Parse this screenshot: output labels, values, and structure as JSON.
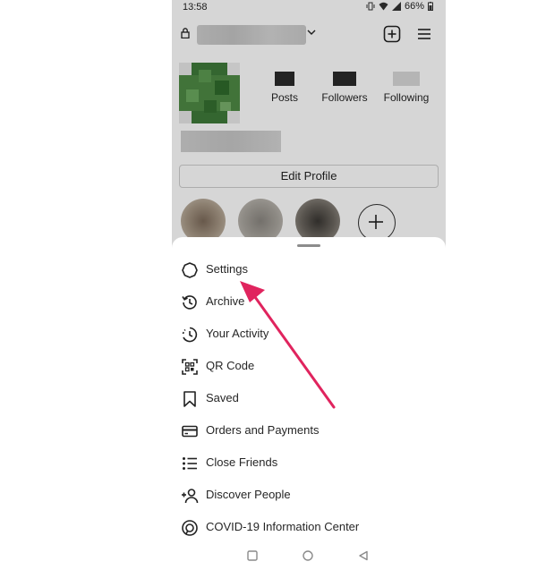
{
  "status_bar": {
    "time": "13:58",
    "battery": "66%"
  },
  "profile": {
    "stats": [
      {
        "label": "Posts"
      },
      {
        "label": "Followers"
      },
      {
        "label": "Following"
      }
    ],
    "edit_profile_label": "Edit Profile"
  },
  "menu": {
    "items": [
      {
        "label": "Settings",
        "icon": "settings-icon"
      },
      {
        "label": "Archive",
        "icon": "archive-icon"
      },
      {
        "label": "Your Activity",
        "icon": "activity-icon"
      },
      {
        "label": "QR Code",
        "icon": "qr-code-icon"
      },
      {
        "label": "Saved",
        "icon": "bookmark-icon"
      },
      {
        "label": "Orders and Payments",
        "icon": "card-icon"
      },
      {
        "label": "Close Friends",
        "icon": "close-friends-icon"
      },
      {
        "label": "Discover People",
        "icon": "add-person-icon"
      },
      {
        "label": "COVID-19 Information Center",
        "icon": "info-center-icon"
      }
    ]
  },
  "colors": {
    "annotation_arrow": "#e0245e",
    "text": "#262626"
  }
}
